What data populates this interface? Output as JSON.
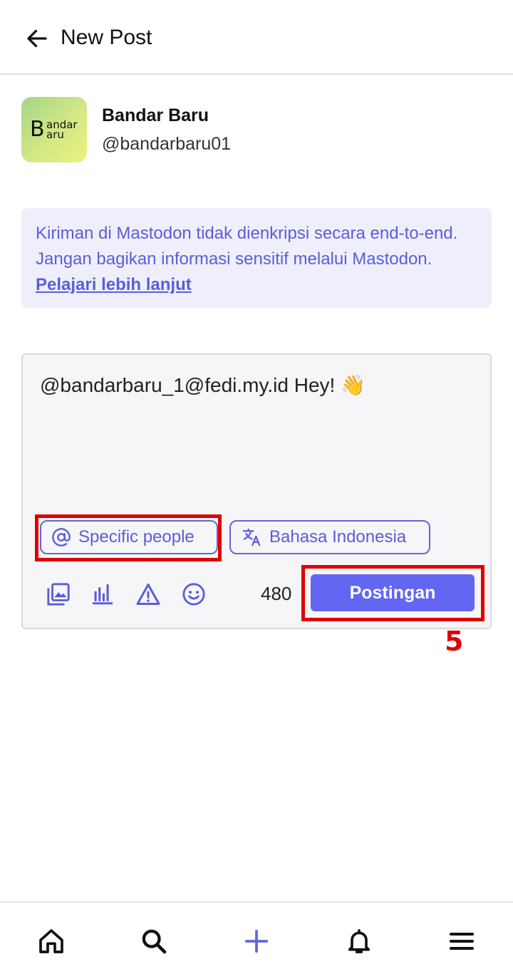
{
  "header": {
    "title": "New Post",
    "back_icon": "arrow-left-icon"
  },
  "profile": {
    "display_name": "Bandar Baru",
    "handle": "@bandarbaru01",
    "avatar": {
      "big_letter": "B",
      "line1": "andar",
      "line2": "aru"
    }
  },
  "notice": {
    "text": "Kiriman di Mastodon tidak dienkripsi secara end-to-end. Jangan bagikan informasi sensitif melalui Mastodon. ",
    "link": "Pelajari lebih lanjut"
  },
  "compose": {
    "text": "@bandarbaru_1@fedi.my.id Hey! 👋",
    "visibility_label": "Specific people",
    "language_label": "Bahasa Indonesia",
    "char_count": "480",
    "post_label": "Postingan",
    "tools": [
      "image-icon",
      "poll-icon",
      "warning-icon",
      "emoji-icon"
    ]
  },
  "annotation": {
    "step": "5",
    "color": "#e00000"
  },
  "colors": {
    "accent": "#6366f1",
    "notice_bg": "#efeffc",
    "notice_text": "#5a5ed8"
  },
  "bottom_nav": [
    "home-icon",
    "search-icon",
    "plus-icon",
    "bell-icon",
    "menu-icon"
  ]
}
